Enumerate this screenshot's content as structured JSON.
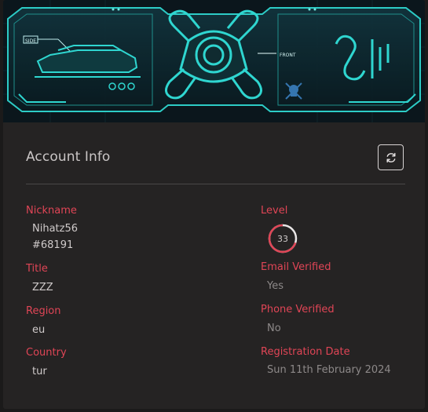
{
  "banner": {
    "side_label": "SIDE",
    "front_label": "FRONT"
  },
  "account": {
    "title": "Account Info",
    "refresh_icon": "refresh-icon"
  },
  "fields": {
    "nickname_label": "Nickname",
    "nickname_name": "Nihatz56",
    "nickname_tag": "#68191",
    "title_label": "Title",
    "title_value": "ZZZ",
    "region_label": "Region",
    "region_value": "eu",
    "country_label": "Country",
    "country_value": "tur",
    "level_label": "Level",
    "level_value": "33",
    "level_progress": 0.7,
    "email_label": "Email Verified",
    "email_value": "Yes",
    "phone_label": "Phone Verified",
    "phone_value": "No",
    "registration_label": "Registration Date",
    "registration_value": "Sun 11th February 2024"
  },
  "colors": {
    "accent": "#e04556",
    "banner_cyan": "#2fd6d0"
  }
}
